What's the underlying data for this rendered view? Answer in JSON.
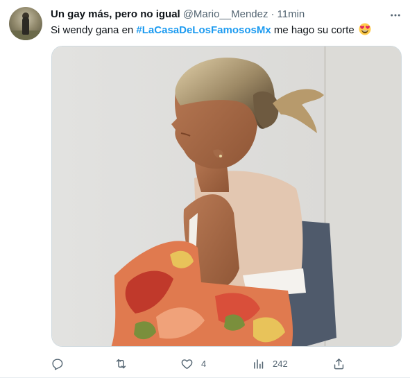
{
  "tweet": {
    "display_name": "Un gay más, pero no igual",
    "handle": "@Mario__Mendez",
    "separator": "·",
    "time": "11min",
    "text_before": "Si wendy gana en ",
    "hashtag": "#LaCasaDeLosFamososMx",
    "text_after": " me hago su corte",
    "emoji": "heart-eyes-emoji"
  },
  "actions": {
    "reply_count": "",
    "retweet_count": "",
    "like_count": "4",
    "views_count": "242"
  },
  "icons": {
    "more": "more-icon",
    "reply": "reply-icon",
    "retweet": "retweet-icon",
    "like": "heart-icon",
    "views": "views-icon",
    "share": "share-icon"
  },
  "colors": {
    "accent": "#1d9bf0",
    "text": "#0f1419",
    "muted": "#536471",
    "border": "#cfd9de"
  }
}
